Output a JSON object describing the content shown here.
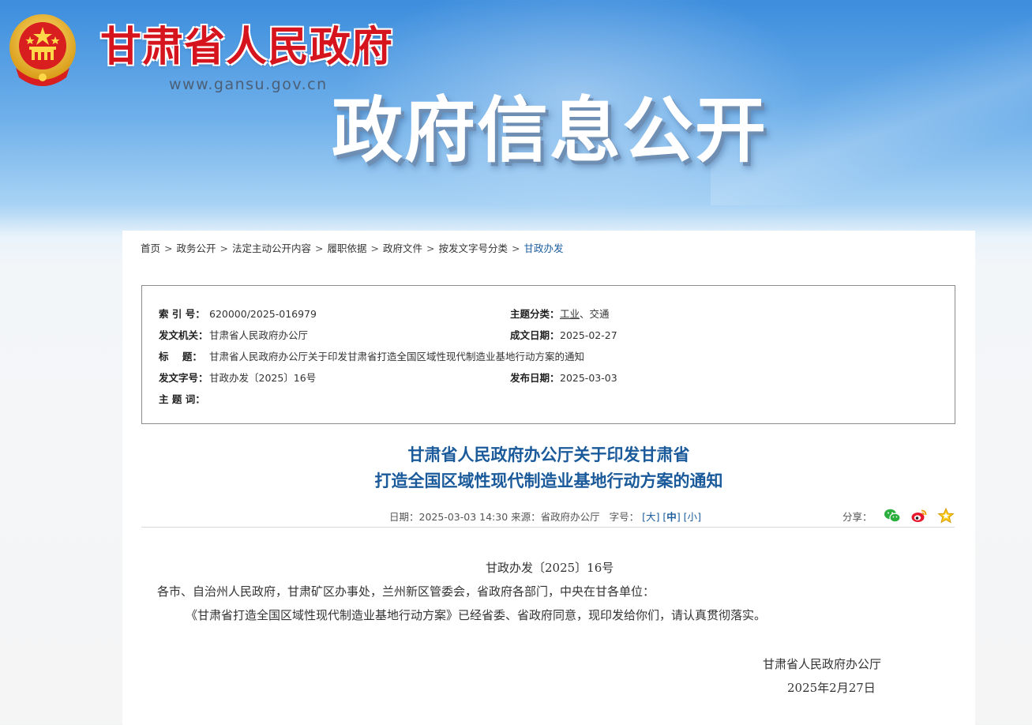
{
  "header": {
    "site_title": "甘肃省人民政府",
    "site_url": "www.gansu.gov.cn",
    "banner_title": "政府信息公开"
  },
  "breadcrumb": [
    {
      "label": "首页"
    },
    {
      "label": "政务公开"
    },
    {
      "label": "法定主动公开内容"
    },
    {
      "label": "履职依据"
    },
    {
      "label": "政府文件"
    },
    {
      "label": "按发文字号分类"
    },
    {
      "label": "甘政办发"
    }
  ],
  "breadcrumb_separator": ">",
  "meta": {
    "index_label": "索 引 号：",
    "index_value": "620000/2025-016979",
    "topic_label": "主题分类：",
    "topic_value_a": "工业",
    "topic_sep": "、",
    "topic_value_b": "交通",
    "issuer_label": "发文机关：",
    "issuer_value": "甘肃省人民政府办公厅",
    "written_label": "成文日期：",
    "written_value": "2025-02-27",
    "title_label": "标    题：",
    "title_value": "甘肃省人民政府办公厅关于印发甘肃省打造全国区域性现代制造业基地行动方案的通知",
    "docno_label": "发文字号：",
    "docno_value": "甘政办发〔2025〕16号",
    "publish_label": "发布日期：",
    "publish_value": "2025-03-03",
    "keywords_label": "主 题 词："
  },
  "article": {
    "title_line1": "甘肃省人民政府办公厅关于印发甘肃省",
    "title_line2": "打造全国区域性现代制造业基地行动方案的通知",
    "date_label": "日期：",
    "date_value": "2025-03-03 14:30",
    "source_label": "来源：",
    "source_value": "省政府办公厅",
    "fontsize_label": "字号：",
    "fs_large": "大",
    "fs_medium": "中",
    "fs_small": "小",
    "share_label": "分享：",
    "doc_number": "甘政办发〔2025〕16号",
    "salutation": "各市、自治州人民政府，甘肃矿区办事处，兰州新区管委会，省政府各部门，中央在甘各单位：",
    "paragraph1": "《甘肃省打造全国区域性现代制造业基地行动方案》已经省委、省政府同意，现印发给你们，请认真贯彻落实。",
    "signature_org": "甘肃省人民政府办公厅",
    "signature_date": "2025年2月27日"
  },
  "colors": {
    "site_red": "#d6141e",
    "link_blue": "#1b5c9c",
    "title_blue": "#1a5a9a"
  },
  "icons": [
    "national-emblem",
    "wechat-icon",
    "weibo-icon",
    "favorite-star-icon"
  ]
}
